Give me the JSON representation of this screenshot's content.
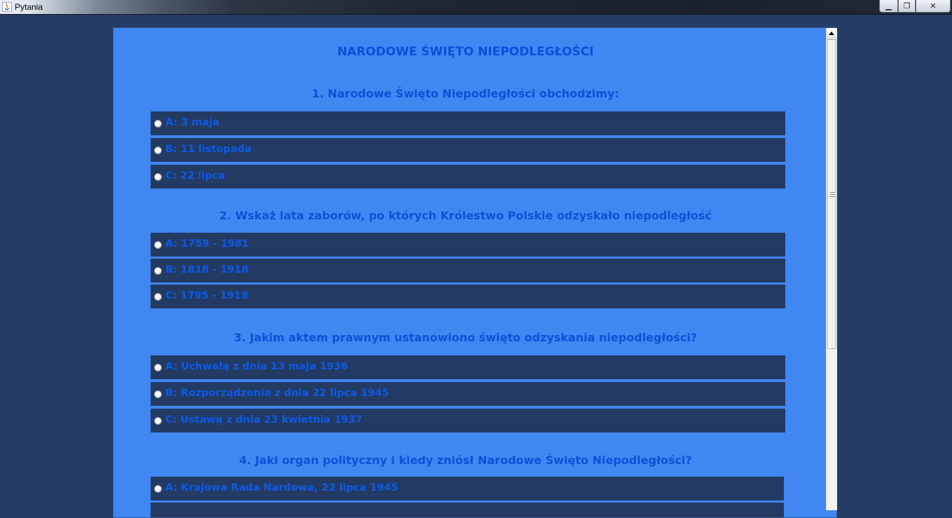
{
  "window": {
    "title": "Pytania",
    "controls": {
      "minimize": "▁",
      "maximize": "❐",
      "close": "✕"
    }
  },
  "page": {
    "title": "NARODOWE ŚWIĘTO NIEPODLEGŁOŚCI",
    "questions": [
      {
        "text": "1. Narodowe Święto Niepodległości obchodzimy:",
        "options": [
          "A: 3 maja",
          "B: 11 listopada",
          "C: 22 lipca"
        ]
      },
      {
        "text": "2. Wskaż lata zaborów, po których Królestwo Polskie odzyskało niepodległość",
        "options": [
          "A: 1759 - 1981",
          "B: 1818 - 1918",
          "C: 1795 - 1918"
        ]
      },
      {
        "text": "3. Jakim aktem prawnym ustanowiono święto odzyskania niepodległości?",
        "options": [
          "A: Uchwałą z dnia 13 maja 1936",
          "B: Rozporządzenia z dnia 22 lipca 1945",
          "C: Ustawą z dnia 23 kwietnia 1937"
        ]
      },
      {
        "text": "4. Jaki organ polityczny i kiedy zniósł Narodowe Święto Niepodległości?",
        "options": [
          "A: Krajowa Rada Nardowa, 22 lipca 1945",
          ""
        ]
      }
    ]
  },
  "colors": {
    "desktop": "#253c64",
    "panel": "#4087f2",
    "option_bg": "#233a63",
    "text": "#0c5ae6"
  },
  "icons": {
    "app": "java-icon",
    "radio": "radio-button-icon"
  }
}
